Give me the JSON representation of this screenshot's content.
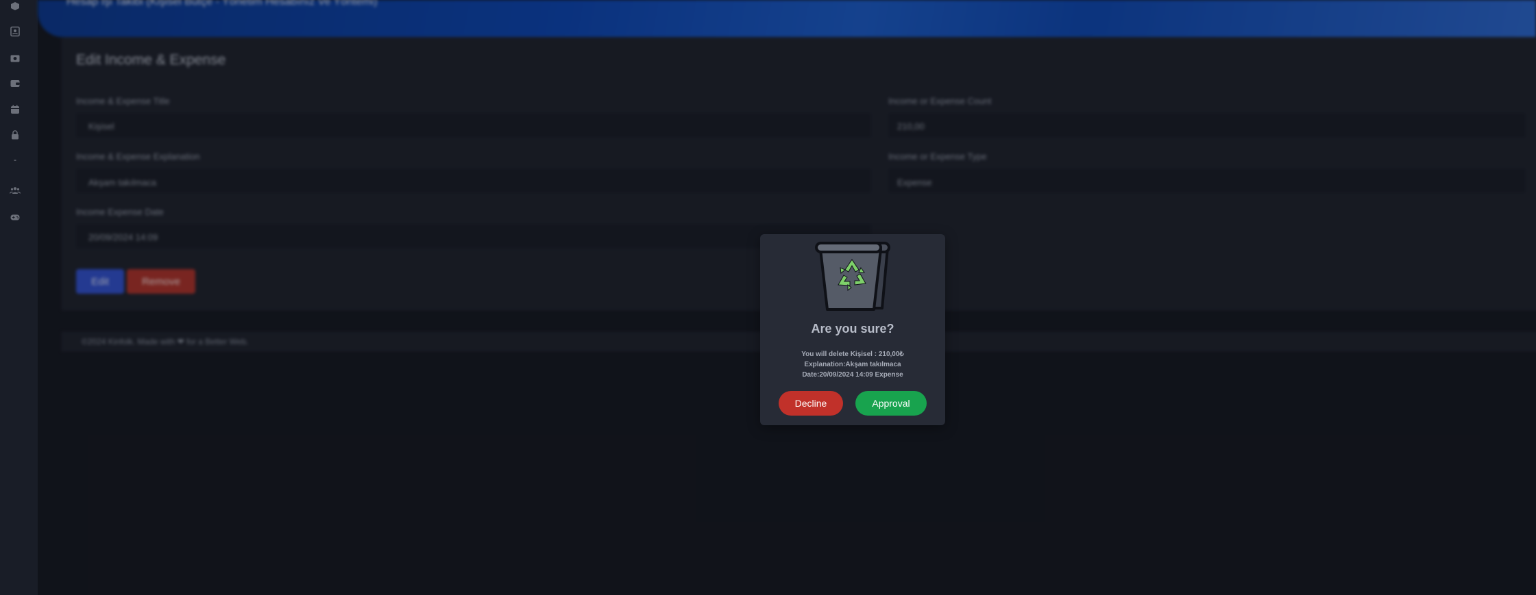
{
  "header": {
    "title": "Hesap İşi Takibi (Kişisel Bütçe - Yönetim Hesabınız Ve Yöntemi)"
  },
  "sidebar": {
    "icons": [
      "box-icon",
      "contact-icon",
      "camera-icon",
      "wallet-icon",
      "calendar-icon",
      "lock-icon",
      "dash-icon",
      "users-icon",
      "gamepad-icon"
    ]
  },
  "form": {
    "title": "Edit Income & Expense",
    "title_label": "Income & Expense Title",
    "title_value": "Kişisel",
    "explanation_label": "Income & Expense Explanation",
    "explanation_value": "Akşam takılmaca",
    "date_label": "Income Expense Date",
    "date_value": "20/09/2024 14:09",
    "count_label": "Income or Expense Count",
    "count_value": "210,00",
    "type_label": "Income or Expense Type",
    "type_value": "Expense",
    "edit_label": "Edit",
    "remove_label": "Remove"
  },
  "footer": {
    "text": "©2024 Kinfolk. Made with ❤ for a Better Web."
  },
  "modal": {
    "title": "Are you sure?",
    "line1": "You will delete Kişisel : 210,00₺",
    "line2": "Explanation:Akşam takılmaca",
    "line3": "Date:20/09/2024 14:09 Expense",
    "decline_label": "Decline",
    "approve_label": "Approval"
  },
  "colors": {
    "decline": "#c1312a",
    "approve": "#18a34e",
    "recycle": "#7ed06a"
  }
}
